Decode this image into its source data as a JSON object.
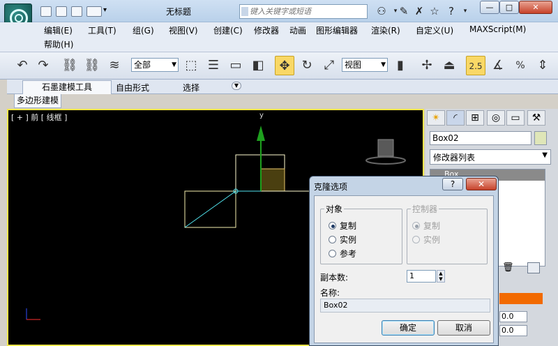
{
  "window": {
    "title": "无标题",
    "search_placeholder": "键入关键字或短语",
    "min_label": "—",
    "max_label": "□",
    "close_label": "✕"
  },
  "menu": {
    "items": [
      "编辑(E)",
      "工具(T)",
      "组(G)",
      "视图(V)",
      "创建(C)",
      "修改器",
      "动画",
      "图形编辑器",
      "渲染(R)",
      "自定义(U)",
      "MAXScript(M)"
    ],
    "help": "帮助(H)"
  },
  "toolbar": {
    "selection_filter": "全部",
    "ref_coord": "视图",
    "snap_value": "2.5",
    "snap_label": "2.5"
  },
  "ribbon": {
    "tabs": [
      "石墨建模工具",
      "自由形式",
      "选择"
    ],
    "subtab": "多边形建模"
  },
  "viewport": {
    "label": "[ + ] 前 [ 线框 ]",
    "axis_y": "y"
  },
  "command_panel": {
    "object_name": "Box02",
    "modifier_list": "修改器列表",
    "stack_item": "Box",
    "spin_values": [
      "0.0",
      "0.0"
    ]
  },
  "clone_dialog": {
    "title": "克隆选项",
    "help_label": "?",
    "close_label": "✕",
    "object_group": "对象",
    "object_options": [
      "复制",
      "实例",
      "参考"
    ],
    "object_selected": "复制",
    "controller_group": "控制器",
    "controller_options": [
      "复制",
      "实例"
    ],
    "copies_label": "副本数:",
    "copies_value": "1",
    "name_label": "名称:",
    "name_value": "Box02",
    "ok_label": "确定",
    "cancel_label": "取消"
  },
  "colors": {
    "viewport_border": "#f5e64a",
    "active_tool": "#f9d866",
    "dialog_frame": "#c4d4e6",
    "gizmo_green": "#1ea01e",
    "wire_cyan": "#52e5ef"
  }
}
